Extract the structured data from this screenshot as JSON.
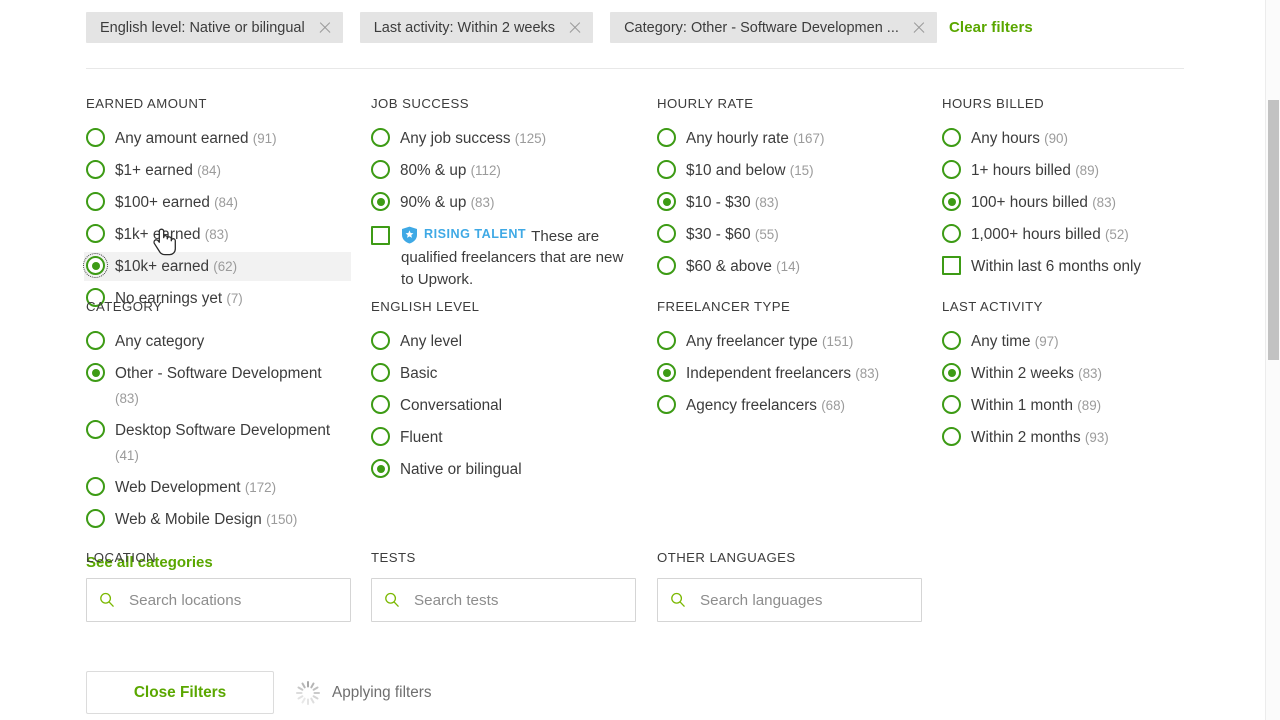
{
  "active_filters": {
    "chips": [
      {
        "label": "English level: Native or bilingual",
        "remove_icon": "close-icon"
      },
      {
        "label": "Last activity: Within 2 weeks",
        "remove_icon": "close-icon"
      },
      {
        "label": "Category: Other - Software Developmen ...",
        "remove_icon": "close-icon"
      }
    ],
    "clear_label": "Clear filters"
  },
  "sections": {
    "earned_amount": {
      "title": "EARNED AMOUNT",
      "options": [
        {
          "label": "Any amount earned",
          "count": "(91)",
          "selected": false
        },
        {
          "label": "$1+ earned",
          "count": "(84)",
          "selected": false
        },
        {
          "label": "$100+ earned",
          "count": "(84)",
          "selected": false
        },
        {
          "label": "$1k+ earned",
          "count": "(83)",
          "selected": false
        },
        {
          "label": "$10k+ earned",
          "count": "(62)",
          "selected": true
        },
        {
          "label": "No earnings yet",
          "count": "(7)",
          "selected": false
        }
      ]
    },
    "job_success": {
      "title": "JOB SUCCESS",
      "options": [
        {
          "label": "Any job success",
          "count": "(125)",
          "selected": false
        },
        {
          "label": "80% & up",
          "count": "(112)",
          "selected": false
        },
        {
          "label": "90% & up",
          "count": "(83)",
          "selected": true
        }
      ],
      "rising_talent": {
        "badge": "RISING TALENT",
        "badge_icon": "shield-star-icon",
        "description": "These are qualified freelancers that are new to Upwork.",
        "checked": false
      }
    },
    "hourly_rate": {
      "title": "HOURLY RATE",
      "options": [
        {
          "label": "Any hourly rate",
          "count": "(167)",
          "selected": false
        },
        {
          "label": "$10 and below",
          "count": "(15)",
          "selected": false
        },
        {
          "label": "$10 - $30",
          "count": "(83)",
          "selected": true
        },
        {
          "label": "$30 - $60",
          "count": "(55)",
          "selected": false
        },
        {
          "label": "$60 & above",
          "count": "(14)",
          "selected": false
        }
      ]
    },
    "hours_billed": {
      "title": "HOURS BILLED",
      "options": [
        {
          "label": "Any hours",
          "count": "(90)",
          "selected": false
        },
        {
          "label": "1+ hours billed",
          "count": "(89)",
          "selected": false
        },
        {
          "label": "100+ hours billed",
          "count": "(83)",
          "selected": true
        },
        {
          "label": "1,000+ hours billed",
          "count": "(52)",
          "selected": false
        }
      ],
      "checkbox": {
        "label": "Within last 6 months only",
        "checked": false
      }
    },
    "category": {
      "title": "CATEGORY",
      "options": [
        {
          "label": "Any category",
          "count": "",
          "selected": false
        },
        {
          "label": "Other - Software Development",
          "count": "(83)",
          "selected": true
        },
        {
          "label": "Desktop Software Development",
          "count": "(41)",
          "selected": false
        },
        {
          "label": "Web Development",
          "count": "(172)",
          "selected": false
        },
        {
          "label": "Web & Mobile Design",
          "count": "(150)",
          "selected": false
        }
      ],
      "see_all_label": "See all categories"
    },
    "english_level": {
      "title": "ENGLISH LEVEL",
      "options": [
        {
          "label": "Any level",
          "count": "",
          "selected": false
        },
        {
          "label": "Basic",
          "count": "",
          "selected": false
        },
        {
          "label": "Conversational",
          "count": "",
          "selected": false
        },
        {
          "label": "Fluent",
          "count": "",
          "selected": false
        },
        {
          "label": "Native or bilingual",
          "count": "",
          "selected": true
        }
      ]
    },
    "freelancer_type": {
      "title": "FREELANCER TYPE",
      "options": [
        {
          "label": "Any freelancer type",
          "count": "(151)",
          "selected": false
        },
        {
          "label": "Independent freelancers",
          "count": "(83)",
          "selected": true
        },
        {
          "label": "Agency freelancers",
          "count": "(68)",
          "selected": false
        }
      ]
    },
    "last_activity": {
      "title": "LAST ACTIVITY",
      "options": [
        {
          "label": "Any time",
          "count": "(97)",
          "selected": false
        },
        {
          "label": "Within 2 weeks",
          "count": "(83)",
          "selected": true
        },
        {
          "label": "Within 1 month",
          "count": "(89)",
          "selected": false
        },
        {
          "label": "Within 2 months",
          "count": "(93)",
          "selected": false
        }
      ]
    }
  },
  "search_fields": [
    {
      "title": "LOCATION",
      "placeholder": "Search locations",
      "value": "",
      "icon": "search-icon"
    },
    {
      "title": "TESTS",
      "placeholder": "Search tests",
      "value": "",
      "icon": "search-icon"
    },
    {
      "title": "OTHER LANGUAGES",
      "placeholder": "Search languages",
      "value": "",
      "icon": "search-icon"
    }
  ],
  "footer": {
    "close_label": "Close Filters",
    "status_text": "Applying filters",
    "status_icon": "spinner-icon"
  },
  "colors": {
    "accent_green": "#5aa700",
    "control_green": "#3d9b15",
    "badge_blue": "#3fa9e5",
    "chip_bg": "#e4e4e4",
    "text": "#3c3c3c",
    "muted": "#9b9b9b"
  }
}
